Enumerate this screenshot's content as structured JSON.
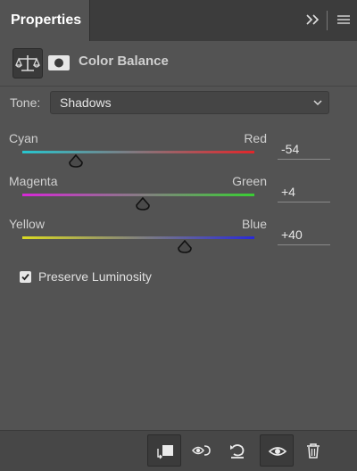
{
  "panel": {
    "tab_label": "Properties",
    "expand_icon": "double-chevron-right-icon",
    "menu_icon": "hamburger-menu-icon"
  },
  "header": {
    "title": "Color Balance",
    "adjustment_icon": "balance-scale-icon",
    "mask_icon": "layer-mask-icon"
  },
  "tone": {
    "label": "Tone:",
    "selected": "Shadows"
  },
  "sliders": [
    {
      "left": "Cyan",
      "right": "Red",
      "value": "-54",
      "numeric": -54,
      "colors": [
        "#27c6cf",
        "#e2262a"
      ]
    },
    {
      "left": "Magenta",
      "right": "Green",
      "value": "+4",
      "numeric": 4,
      "colors": [
        "#d728d8",
        "#39cf33"
      ]
    },
    {
      "left": "Yellow",
      "right": "Blue",
      "value": "+40",
      "numeric": 40,
      "colors": [
        "#dada22",
        "#2929d8"
      ]
    }
  ],
  "preserve_luminosity": {
    "label": "Preserve Luminosity",
    "checked": true
  },
  "bottom_toolbar": [
    {
      "icon": "clip-to-layer-icon",
      "selected": true
    },
    {
      "icon": "view-previous-state-icon",
      "selected": false
    },
    {
      "icon": "reset-icon",
      "selected": false
    },
    {
      "icon": "visibility-eye-icon",
      "selected": true
    },
    {
      "icon": "trash-icon",
      "selected": false
    }
  ]
}
